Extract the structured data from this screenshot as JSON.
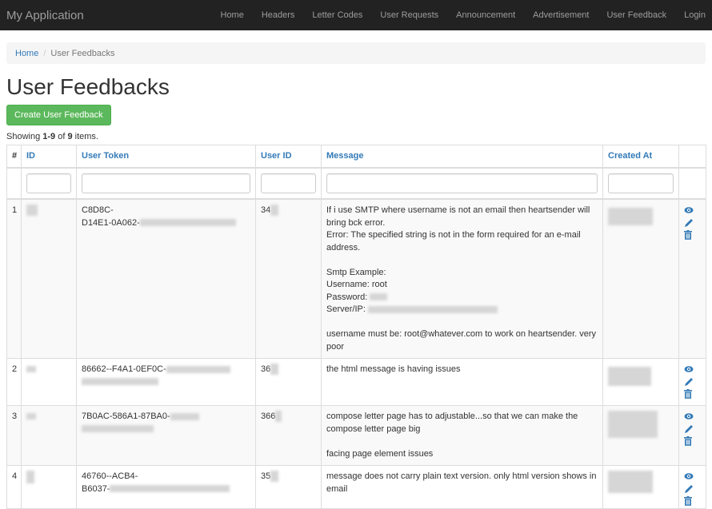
{
  "navbar": {
    "brand": "My Application",
    "items": [
      "Home",
      "Headers",
      "Letter Codes",
      "User Requests",
      "Announcement",
      "Advertisement",
      "User Feedback",
      "Login"
    ]
  },
  "breadcrumb": {
    "home": "Home",
    "separator": "/",
    "current": "User Feedbacks"
  },
  "page_title": "User Feedbacks",
  "create_button": "Create User Feedback",
  "summary": {
    "prefix": "Showing ",
    "range": "1-9",
    "of": " of ",
    "total": "9",
    "suffix": " items."
  },
  "table": {
    "columns": {
      "index": "#",
      "id": "ID",
      "user_token": "User Token",
      "user_id": "User ID",
      "message": "Message",
      "created_at": "Created At"
    },
    "rows": [
      {
        "index": "1",
        "token_line1": "C8D8C-",
        "token_line2": "D14E1-0A062-",
        "user_id": "34",
        "message": [
          "If i use SMTP where username is not an email then heartsender will bring bck error.",
          "Error: The specified string is not in the form required for an e-mail address.",
          "",
          "Smtp Example:",
          "Username: root",
          "Password: ",
          "Server/IP: ",
          "",
          "username must be: root@whatever.com to work on heartsender. very poor"
        ]
      },
      {
        "index": "2",
        "token_line1": "86662--F4A1-0EF0C-",
        "token_line2": "",
        "user_id": "36",
        "message": [
          "the html message is having issues"
        ]
      },
      {
        "index": "3",
        "token_line1": "7B0AC-586A1-87BA0-",
        "token_line2": "",
        "user_id": "366",
        "message": [
          "compose letter page has to adjustable...so that we can make the compose letter page big",
          "",
          "facing page element issues"
        ]
      },
      {
        "index": "4",
        "token_line1": "46760--ACB4-",
        "token_line2": "B6037-",
        "user_id": "35",
        "message": [
          "message does not carry plain text version. only html version shows in email"
        ]
      }
    ]
  },
  "colors": {
    "navbar": "#222222",
    "link": "#337ab7",
    "success": "#5cb85c"
  }
}
